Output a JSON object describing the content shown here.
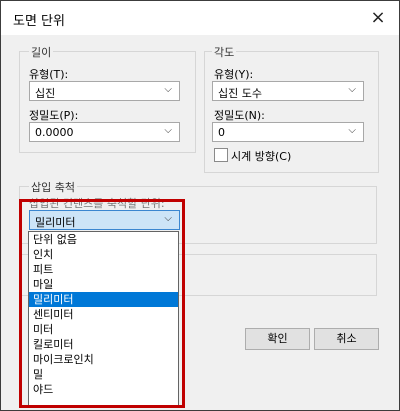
{
  "window": {
    "title": "도면 단위",
    "close_icon": "×"
  },
  "length": {
    "group_label": "길이",
    "type_label": "유형(T):",
    "type_value": "십진",
    "precision_label": "정밀도(P):",
    "precision_value": "0.0000"
  },
  "angle": {
    "group_label": "각도",
    "type_label": "유형(Y):",
    "type_value": "십진 도수",
    "precision_label": "정밀도(N):",
    "precision_value": "0",
    "clockwise_label": "시계 방향(C)"
  },
  "insertion": {
    "group_label": "삽입 축척",
    "caption": "삽입된 컨텐츠를 축척할 단위:",
    "selected_value": "밀리미터",
    "options": [
      "단위 없음",
      "인치",
      "피트",
      "마일",
      "밀리미터",
      "센티미터",
      "미터",
      "킬로미터",
      "마이크로인치",
      "밀",
      "야드"
    ],
    "selected_index": 4
  },
  "buttons": {
    "ok": "확인",
    "cancel": "취소"
  },
  "icons": {
    "chevron": "chevron-down-icon",
    "close": "close-icon"
  },
  "colors": {
    "highlight": "#c00000",
    "selection": "#0078d7",
    "active_field": "#cce4f7"
  }
}
